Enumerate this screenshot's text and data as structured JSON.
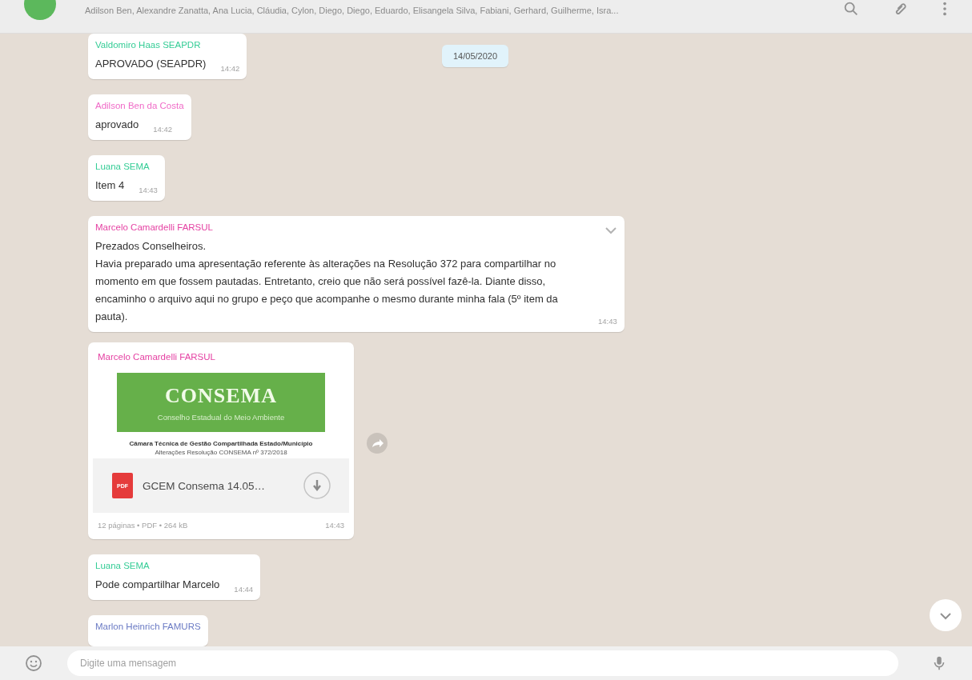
{
  "header": {
    "participants": "Adilson Ben, Alexandre Zanatta, Ana Lucia, Cláudia, Cylon, Diego, Diego, Eduardo, Elisangela Silva, Fabiani, Gerhard, Guilherme, Isra..."
  },
  "date_chip": "14/05/2020",
  "messages": [
    {
      "kind": "text",
      "sender": "Valdomiro Haas SEAPDR",
      "color": "#35cd96",
      "paragraphs": [
        "APROVADO (SEAPDR)"
      ],
      "time": "14:42"
    },
    {
      "kind": "text",
      "sender": "Adilson Ben da Costa",
      "color": "#f06bc7",
      "paragraphs": [
        "aprovado"
      ],
      "time": "14:42"
    },
    {
      "kind": "text",
      "sender": "Luana SEMA",
      "color": "#35cd96",
      "paragraphs": [
        "Item 4"
      ],
      "time": "14:43"
    },
    {
      "kind": "text",
      "sender": "Marcelo Camardelli FARSUL",
      "color": "#e542a3",
      "menu": true,
      "paragraphs": [
        "Prezados Conselheiros.",
        "Havia preparado uma apresentação referente às alterações na Resolução 372 para compartilhar no momento em que fossem pautadas. Entretanto, creio que não será possível fazê-la. Diante disso, encaminho o arquivo aqui no grupo e peço que acompanhe o mesmo durante minha fala (5º item da pauta)."
      ],
      "time": "14:43"
    },
    {
      "kind": "document",
      "sender": "Marcelo Camardelli FARSUL",
      "color": "#e542a3",
      "preview": {
        "title": "CONSEMA",
        "subtitle": "Conselho Estadual do Meio Ambiente",
        "line_1": "Câmara Técnica de Gestão Compartilhada Estado/Município",
        "line_2": "Alterações Resolução CONSEMA nº 372/2018"
      },
      "file_icon": "PDF",
      "file_name": "GCEM Consema 14.05…",
      "meta": "12 páginas • PDF • 264 kB",
      "time": "14:43"
    },
    {
      "kind": "text",
      "sender": "Luana SEMA",
      "color": "#35cd96",
      "paragraphs": [
        "Pode compartilhar Marcelo"
      ],
      "time": "14:44"
    },
    {
      "kind": "partial",
      "sender": "Marlon Heinrich FAMURS",
      "color": "#6b7bc4"
    }
  ],
  "composer": {
    "placeholder": "Digite uma mensagem"
  }
}
